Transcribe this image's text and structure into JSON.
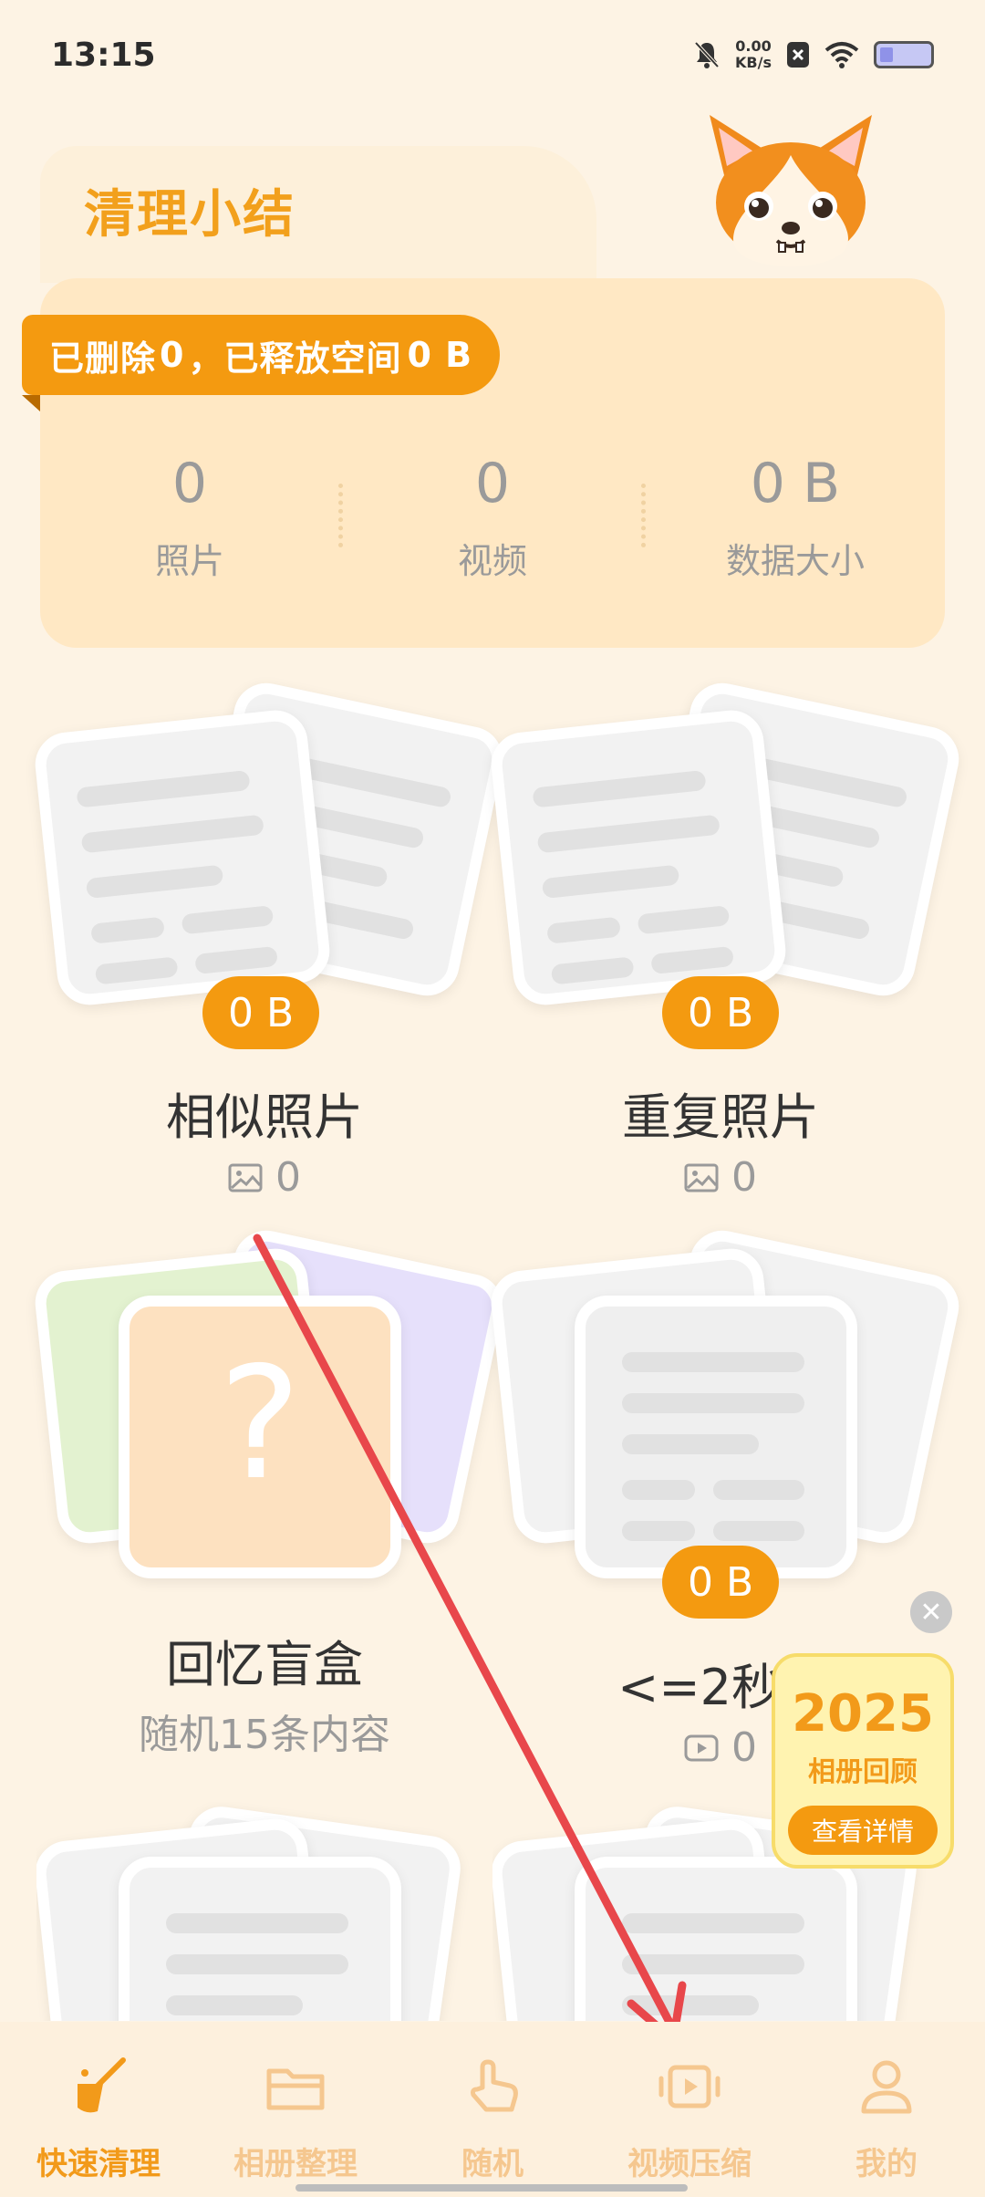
{
  "status_bar": {
    "time": "13:15",
    "net_speed_value": "0.00",
    "net_speed_unit": "KB/s"
  },
  "summary": {
    "title": "清理小结",
    "banner_prefix": "已删除",
    "deleted_count": "0",
    "banner_middle": "，已释放空间",
    "freed_space": "0 B",
    "stats": [
      {
        "value": "0",
        "label": "照片"
      },
      {
        "value": "0",
        "label": "视频"
      },
      {
        "value": "0 B",
        "label": "数据大小"
      }
    ]
  },
  "features": {
    "similar": {
      "title": "相似照片",
      "size": "0 B",
      "count": "0",
      "icon": "image-icon"
    },
    "duplicate": {
      "title": "重复照片",
      "size": "0 B",
      "count": "0",
      "icon": "image-icon"
    },
    "blindbox": {
      "title": "回忆盲盒",
      "subtitle": "随机15条内容"
    },
    "short_video": {
      "title": "<=2秒视",
      "size": "0 B",
      "count": "0",
      "icon": "video-icon"
    }
  },
  "promo": {
    "year": "2025",
    "subtitle": "相册回顾",
    "button": "查看详情"
  },
  "bottom_nav": [
    {
      "label": "快速清理",
      "icon": "broom-icon",
      "active": true
    },
    {
      "label": "相册整理",
      "icon": "folder-icon",
      "active": false
    },
    {
      "label": "随机",
      "icon": "hand-pointer-icon",
      "active": false
    },
    {
      "label": "视频压缩",
      "icon": "video-compress-icon",
      "active": false
    },
    {
      "label": "我的",
      "icon": "user-icon",
      "active": false
    }
  ],
  "colors": {
    "accent": "#f49a10",
    "background": "#fdf3e4",
    "card": "#ffe8c4",
    "annotation_arrow": "#e8474b"
  }
}
